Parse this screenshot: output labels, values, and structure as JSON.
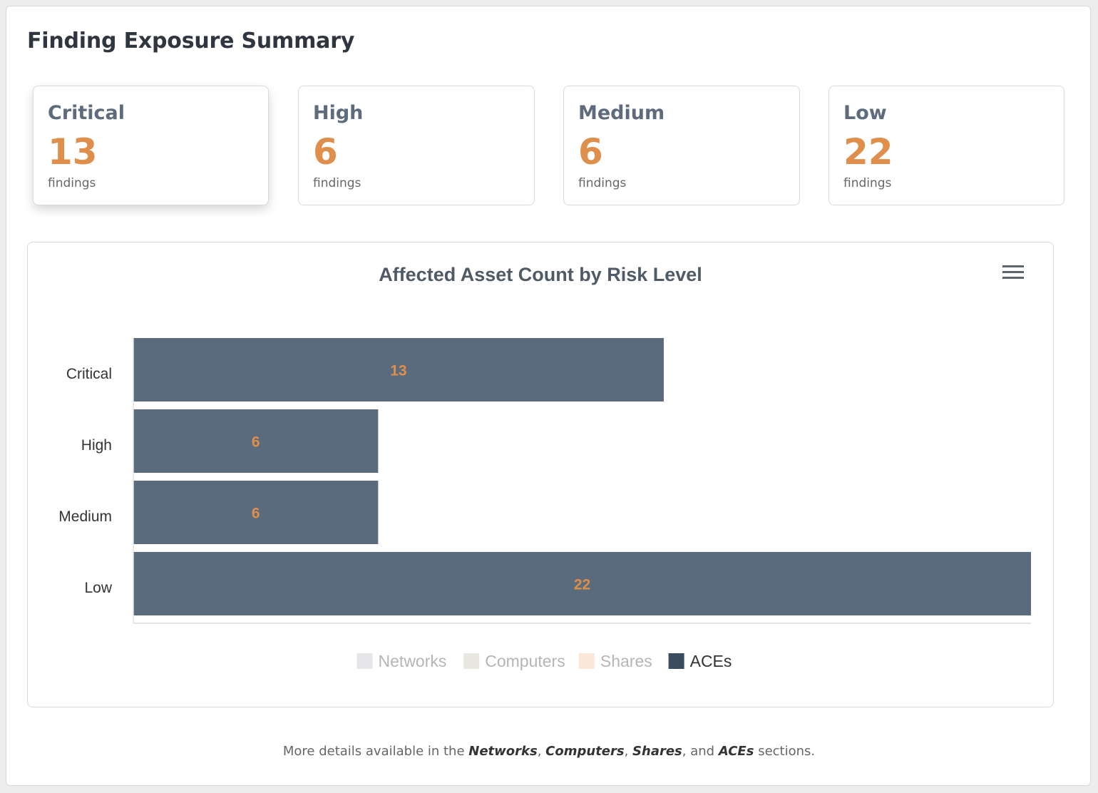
{
  "title": "Finding Exposure Summary",
  "cards": [
    {
      "label": "Critical",
      "count": "13",
      "unit": "findings"
    },
    {
      "label": "High",
      "count": "6",
      "unit": "findings"
    },
    {
      "label": "Medium",
      "count": "6",
      "unit": "findings"
    },
    {
      "label": "Low",
      "count": "22",
      "unit": "findings"
    }
  ],
  "menu_icon": "hamburger-menu-icon",
  "colors": {
    "accent": "#e08e4b",
    "bar": "#5a6b7d"
  },
  "chart_data": {
    "type": "bar",
    "orientation": "horizontal",
    "stacked": true,
    "title": "Affected Asset Count by Risk Level",
    "categories": [
      "Critical",
      "High",
      "Medium",
      "Low"
    ],
    "xlim": [
      0,
      22
    ],
    "series": [
      {
        "name": "Networks",
        "values": [
          0,
          0,
          0,
          0
        ],
        "color": "#e6e6ea"
      },
      {
        "name": "Computers",
        "values": [
          0,
          0,
          0,
          0
        ],
        "color": "#e8e8e0"
      },
      {
        "name": "Shares",
        "values": [
          0,
          0,
          0,
          0
        ],
        "color": "#fbe8d9"
      },
      {
        "name": "ACEs",
        "values": [
          13,
          6,
          6,
          22
        ],
        "color": "#5a6b7d"
      }
    ],
    "data_labels": [
      "13",
      "6",
      "6",
      "22"
    ],
    "legend": "bottom",
    "legend_inactive": [
      "Networks",
      "Computers",
      "Shares"
    ],
    "grid": false
  },
  "footer": {
    "prefix": "More details available in the",
    "networks": "Networks",
    "computers": "Computers",
    "shares": "Shares",
    "and": "and",
    "aces": "ACEs",
    "suffix": "sections."
  }
}
